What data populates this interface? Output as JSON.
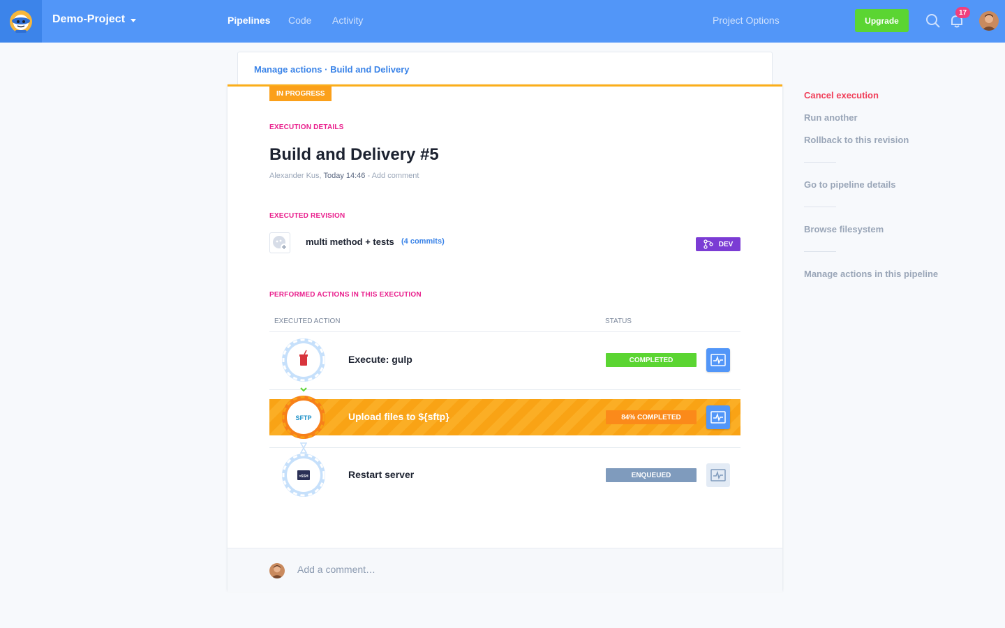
{
  "topbar": {
    "project_name": "Demo-Project",
    "nav": [
      {
        "label": "Pipelines",
        "active": true
      },
      {
        "label": "Code",
        "active": false
      },
      {
        "label": "Activity",
        "active": false
      }
    ],
    "project_options": "Project Options",
    "upgrade_label": "Upgrade",
    "notification_count": "17",
    "icons": [
      "logo-icon",
      "search-icon",
      "bell-icon",
      "user-avatar"
    ]
  },
  "breadcrumb": {
    "parent": "Manage actions",
    "separator": " · ",
    "current": "Build and Delivery"
  },
  "execution": {
    "status": "IN PROGRESS",
    "details_label": "EXECUTION DETAILS",
    "title": "Build and Delivery #5",
    "author": "Alexander Kus,",
    "time": "Today 14:46",
    "comment_link": "- Add comment"
  },
  "revision": {
    "label": "EXECUTED REVISION",
    "message": "multi method + tests",
    "commits": "(4 commits)",
    "branch": "DEV"
  },
  "actions_section": {
    "label": "PERFORMED ACTIONS IN THIS EXECUTION",
    "col_action": "EXECUTED ACTION",
    "col_status": "STATUS",
    "rows": [
      {
        "name": "Execute: gulp",
        "status": "COMPLETED",
        "status_color": "#5bd532",
        "icon": "gulp-icon"
      },
      {
        "name": "Upload files to ${sftp}",
        "status": "84% COMPLETED",
        "status_color": "#fb8a1a",
        "icon": "sftp-icon",
        "progress": 0.84
      },
      {
        "name": "Restart server",
        "status": "ENQUEUED",
        "status_color": "#7f9bbd",
        "icon": "ssh-icon"
      }
    ]
  },
  "comment": {
    "placeholder": "Add a comment…"
  },
  "sidebar": {
    "cancel": "Cancel execution",
    "run_another": "Run another",
    "rollback": "Rollback to this revision",
    "pipeline_details": "Go to pipeline details",
    "browse": "Browse filesystem",
    "manage": "Manage actions in this pipeline"
  },
  "colors": {
    "nav_bg": "#5296f8",
    "in_progress": "#fba01a",
    "accent_pink": "#e91e8c",
    "link_blue": "#3b84e8",
    "danger": "#f0405a",
    "branch_purple": "#7b3cd4"
  }
}
